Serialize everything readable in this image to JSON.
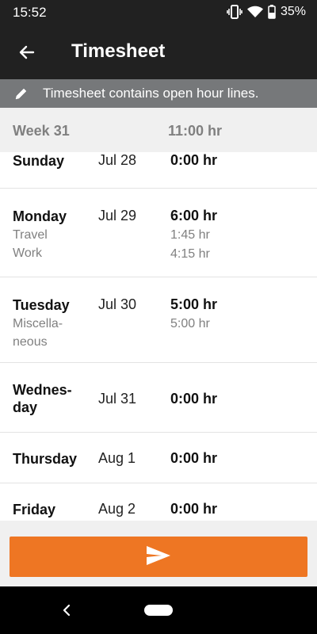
{
  "status_bar": {
    "time": "15:52",
    "battery": "35%"
  },
  "app_bar": {
    "title": "Timesheet"
  },
  "banner": {
    "text": "Timesheet contains open hour lines."
  },
  "week": {
    "label": "Week 31",
    "total": "11:00 hr"
  },
  "days": [
    {
      "name": "Sunday",
      "date": "Jul 28",
      "hours": "0:00 hr",
      "lines": []
    },
    {
      "name": "Monday",
      "date": "Jul 29",
      "hours": "6:00 hr",
      "lines": [
        {
          "category": "Travel",
          "hours": "1:45 hr"
        },
        {
          "category": "Work",
          "hours": "4:15 hr"
        }
      ]
    },
    {
      "name": "Tuesday",
      "date": "Jul 30",
      "hours": "5:00 hr",
      "lines": [
        {
          "category": "Miscella-\nneous",
          "hours": "5:00 hr"
        }
      ]
    },
    {
      "name": "Wednes-\nday",
      "date": "Jul 31",
      "hours": "0:00 hr",
      "lines": []
    },
    {
      "name": "Thursday",
      "date": "Aug 1",
      "hours": "0:00 hr",
      "lines": []
    },
    {
      "name": "Friday",
      "date": "Aug 2",
      "hours": "0:00 hr",
      "lines": []
    }
  ],
  "colors": {
    "accent": "#ee7623",
    "app_bar": "#212121",
    "banner": "#76787a"
  },
  "icons": {
    "back": "arrow-left-icon",
    "edit": "pencil-icon",
    "submit": "send-icon"
  }
}
